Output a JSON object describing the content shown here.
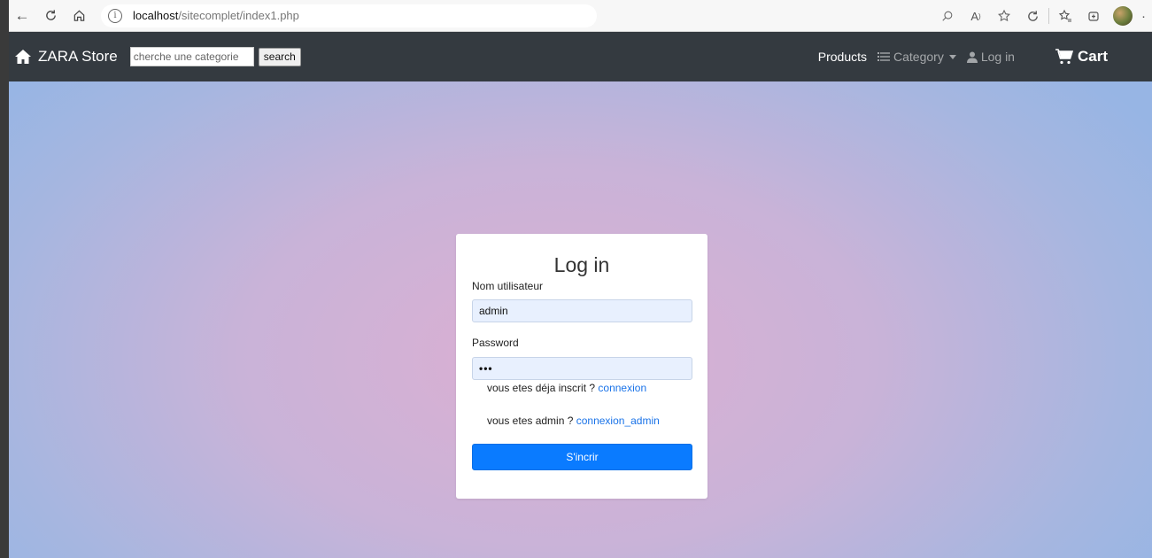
{
  "browser": {
    "url_host": "localhost",
    "url_path": "/sitecomplet/index1.php"
  },
  "navbar": {
    "brand": "ZARA Store",
    "search_placeholder": "cherche une categorie",
    "search_button": "search",
    "links": {
      "products": "Products",
      "category": "Category",
      "login": "Log in",
      "cart": "Cart"
    }
  },
  "login_card": {
    "title": "Log in",
    "username_label": "Nom utilisateur",
    "username_value": "admin",
    "password_label": "Password",
    "password_value": "•••",
    "already_registered_text": "vous etes déja inscrit ? ",
    "already_registered_link": "connexion",
    "admin_text": "vous etes admin ? ",
    "admin_link": "connexion_admin",
    "submit_label": "S'incrir"
  },
  "colors": {
    "navbar_bg": "#343a40",
    "primary": "#0a7bff",
    "link": "#1a73e8",
    "input_bg": "#e8f0fe"
  }
}
